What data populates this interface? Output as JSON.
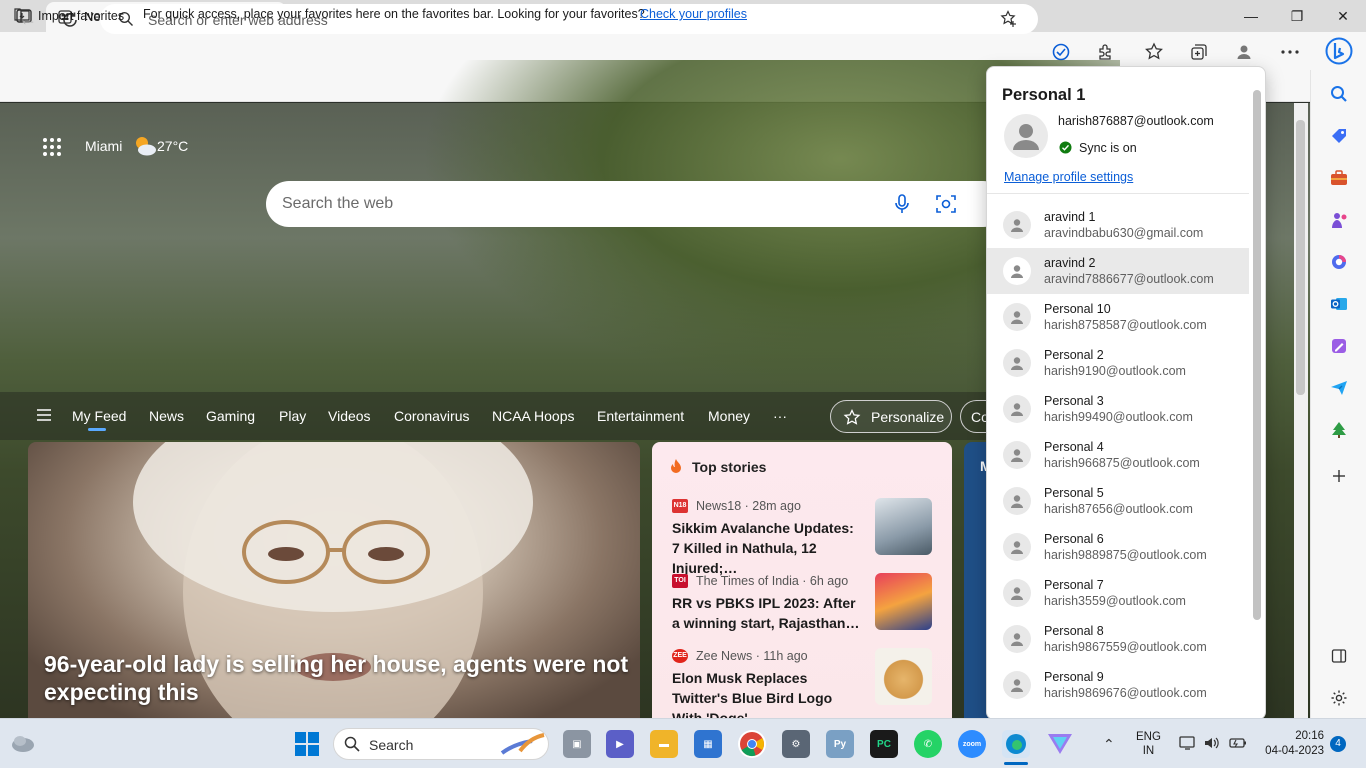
{
  "browser": {
    "tab_title": "New tab",
    "tab_close": "✕",
    "new_tab": "+",
    "window_controls": {
      "minimize": "—",
      "maximize": "❐",
      "close": "✕"
    },
    "address_placeholder": "Search or enter web address"
  },
  "favorites_bar": {
    "import_label": "Import favorites",
    "message": "For quick access, place your favorites here on the favorites bar. Looking for your favorites?",
    "link_label": "Check your profiles"
  },
  "newtab": {
    "weather_city": "Miami",
    "weather_temp": "27°C",
    "search_placeholder": "Search the web",
    "feed_tabs": [
      "My Feed",
      "News",
      "Gaming",
      "Play",
      "Videos",
      "Coronavirus",
      "NCAA Hoops",
      "Entertainment",
      "Money",
      "···"
    ],
    "personalize_label": "Personalize",
    "next_chip_label": "Co",
    "hero_title": "96-year-old lady is selling her house, agents were not expecting this",
    "blue_card_label": "M",
    "top_stories": {
      "title": "Top stories",
      "items": [
        {
          "logo": "N18",
          "logo_color": "#d33",
          "source": "News18 · 28m ago",
          "headline": "Sikkim Avalanche Updates: 7 Killed in Nathula, 12 Injured;…"
        },
        {
          "logo": "TOI",
          "logo_color": "#c8102e",
          "source": "The Times of India · 6h ago",
          "headline": "RR vs PBKS IPL 2023: After a winning start, Rajasthan…"
        },
        {
          "logo": "ZEE",
          "logo_color": "#e1251b",
          "source": "Zee News · 11h ago",
          "headline": "Elon Musk Replaces Twitter's Blue Bird Logo With 'Doge'…"
        }
      ]
    }
  },
  "profile_panel": {
    "heading": "Personal 1",
    "email": "harish876887@outlook.com",
    "sync_status": "Sync is on",
    "manage_link": "Manage profile settings",
    "profiles": [
      {
        "name": "aravind 1",
        "email": "aravindbabu630@gmail.com"
      },
      {
        "name": "aravind 2",
        "email": "aravind7886677@outlook.com"
      },
      {
        "name": "Personal 10",
        "email": "harish8758587@outlook.com"
      },
      {
        "name": "Personal 2",
        "email": "harish9190@outlook.com"
      },
      {
        "name": "Personal 3",
        "email": "harish99490@outlook.com"
      },
      {
        "name": "Personal 4",
        "email": "harish966875@outlook.com"
      },
      {
        "name": "Personal 5",
        "email": "harish87656@outlook.com"
      },
      {
        "name": "Personal 6",
        "email": "harish9889875@outlook.com"
      },
      {
        "name": "Personal 7",
        "email": "harish3559@outlook.com"
      },
      {
        "name": "Personal 8",
        "email": "harish9867559@outlook.com"
      },
      {
        "name": "Personal 9",
        "email": "harish9869676@outlook.com"
      }
    ]
  },
  "taskbar": {
    "search_label": "Search",
    "lang_top": "ENG",
    "lang_bottom": "IN",
    "time": "20:16",
    "date": "04-04-2023",
    "notification_count": "4"
  },
  "colors": {
    "accent": "#0b5ed7",
    "sync_ok": "#107c10"
  }
}
